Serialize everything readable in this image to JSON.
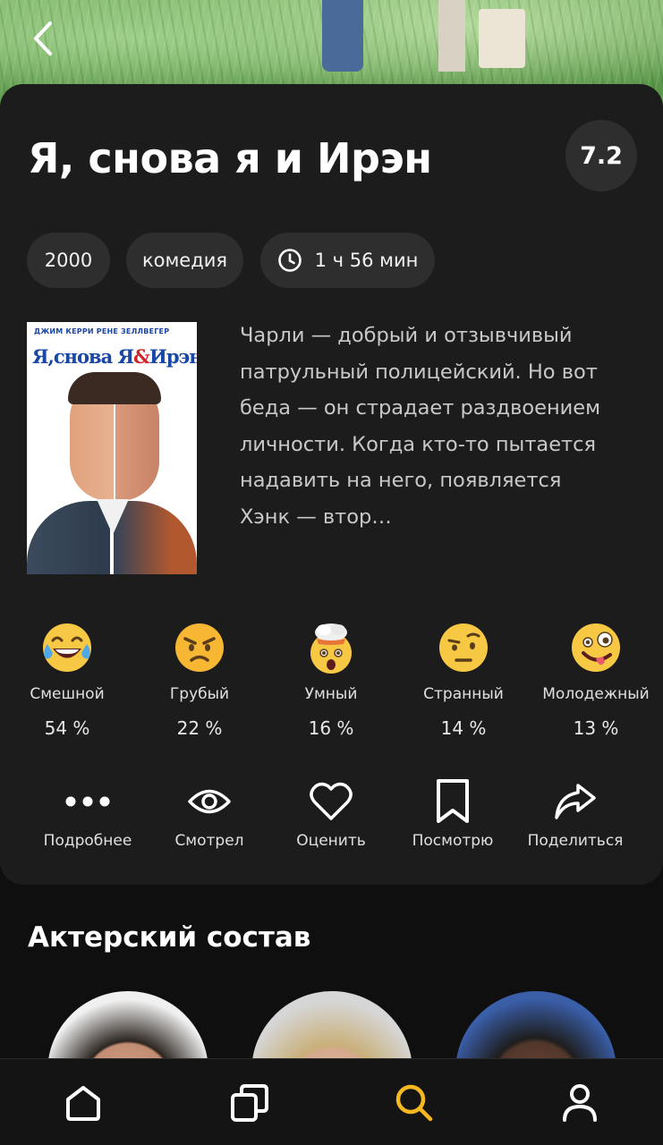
{
  "movie": {
    "title": "Я, снова я и Ирэн",
    "rating": "7.2",
    "year": "2000",
    "genre": "комедия",
    "duration": "1 ч 56 мин",
    "description": "Чарли — добрый и отзывчивый патрульный полицейский. Но вот беда — он страдает раздвоением личности. Когда кто-то пытается надавить на него, появляется Хэнк — втор…",
    "poster": {
      "top_text": "ДЖИМ КЕРРИ   РЕНЕ ЗЕЛЛВЕГЕР",
      "title_left": "Я,снова Я",
      "title_amp": "&",
      "title_right": "Ирэн"
    }
  },
  "reactions": [
    {
      "icon": "laughing-tears-emoji",
      "label": "Смешной",
      "percent": "54 %"
    },
    {
      "icon": "angry-face-emoji",
      "label": "Грубый",
      "percent": "22 %"
    },
    {
      "icon": "exploding-head-emoji",
      "label": "Умный",
      "percent": "16 %"
    },
    {
      "icon": "raised-eyebrow-emoji",
      "label": "Странный",
      "percent": "14 %"
    },
    {
      "icon": "zany-face-emoji",
      "label": "Молодежный",
      "percent": "13 %"
    }
  ],
  "actions": [
    {
      "icon": "more-dots-icon",
      "label": "Подробнее"
    },
    {
      "icon": "eye-icon",
      "label": "Смотрел"
    },
    {
      "icon": "heart-icon",
      "label": "Оценить"
    },
    {
      "icon": "bookmark-icon",
      "label": "Посмотрю"
    },
    {
      "icon": "share-arrow-icon",
      "label": "Поделиться"
    }
  ],
  "cast_section": {
    "title": "Актерский состав"
  },
  "tabbar": {
    "items": [
      "home-icon",
      "collections-icon",
      "search-icon",
      "profile-icon"
    ],
    "active": "search-icon",
    "active_color": "#f5b820",
    "inactive_color": "#ffffff"
  },
  "colors": {
    "background": "#0f0f0f",
    "card": "#1c1c1c",
    "chip": "#2e2e2e",
    "accent": "#f5b820"
  }
}
